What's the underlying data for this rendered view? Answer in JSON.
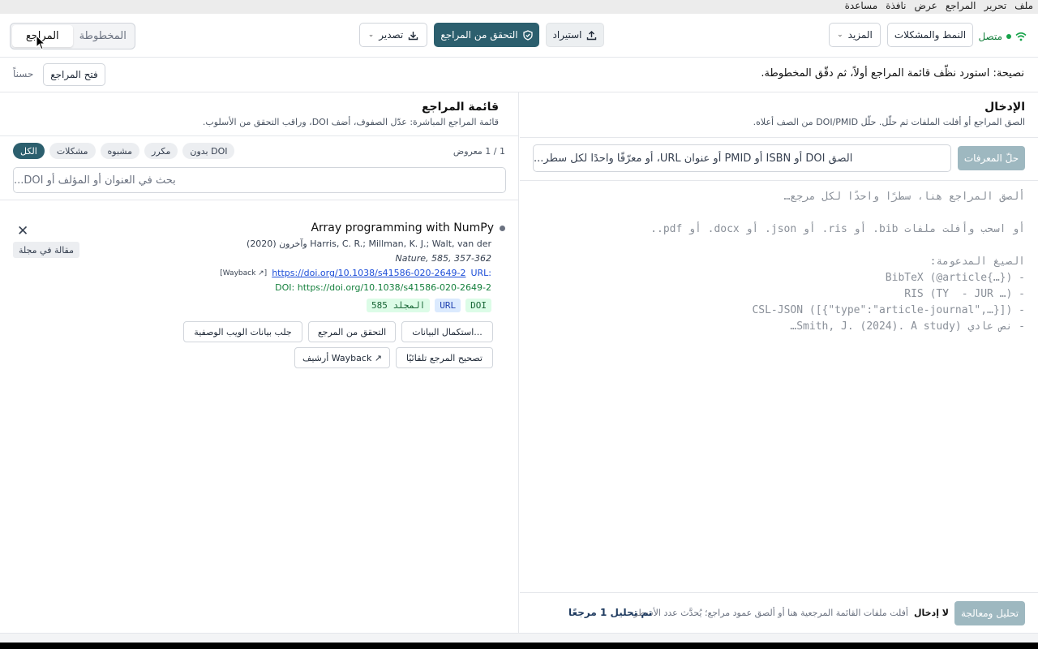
{
  "menu": [
    "ملف",
    "تحرير",
    "المراجع",
    "عرض",
    "نافذة",
    "مساعدة"
  ],
  "toolbar": {
    "status": "متصل",
    "issues_label": "النمط والمشكلات",
    "more_label": "المزيد",
    "import_label": "استيراد",
    "verify_label": "التحقق من المراجع",
    "export_label": "تصدير",
    "tab_manuscript": "المخطوطة",
    "tab_references": "المراجع"
  },
  "tip": {
    "text": "نصيحة: استورد نظّف قائمة المراجع أولاً، ثم دقّق المخطوطة.",
    "open_label": "فتح المراجع",
    "ok_label": "حسناً"
  },
  "input_panel": {
    "title": "الإدخال",
    "subtitle": "الصق المراجع أو أفلت الملفات ثم حلّل. حلّل DOI/PMID من الصف أعلاه.",
    "resolve_label": "حلّ المعرفات",
    "identifier_placeholder": "الصق DOI أو ISBN أو PMID أو عنوان URL، أو معرّفًا واحدًا لكل سطر...",
    "textarea_lines": [
      "ألصق المراجع هنا، سطرًا واحدًا لكل مرجع…",
      "",
      "أو اسحب وأفلت ملفات bib. أو ris. أو json. أو docx. أو pdf..",
      "",
      "الصيغ المدعومة:",
      "- BibTeX (@article{…})",
      "- RIS (TY  - JUR …)",
      "- CSL-JSON ([{\"type\":\"article-journal\",…}])",
      "- نص عادي (Smith, J. (2024). A study…"
    ],
    "parse_label": "تحليل ومعالجة",
    "footer_hint_bold": "لا إدخال",
    "footer_hint": "أفلت ملفات القائمة المرجعية هنا أو ألصق عمود مراجع؛ يُحدَّث عدد الأسطر.",
    "footer_status": "تم تحليل 1 مرجعًا"
  },
  "ref_panel": {
    "title": "قائمة المراجع",
    "subtitle": "قائمة المراجع المباشرة: عدّل الصفوف، أضف DOI، وراقب التحقق من الأسلوب.",
    "count": "1 / 1 معروض",
    "filters": [
      "بدون DOI",
      "مكرر",
      "مشبوه",
      "مشكلات",
      "الكل"
    ],
    "search_placeholder": "بحث في العنوان أو المؤلف أو DOI..."
  },
  "reference": {
    "title": "Array programming with NumPy",
    "authors": "Harris, C. R.; Millman, K. J.; Walt, van der وآخرون (2020)",
    "journal": "Nature, 585, 357-362",
    "url_label": "URL:",
    "url": "https://doi.org/10.1038/s41586-020-2649-2",
    "wayback": "[Wayback ↗]",
    "doi": "DOI: https://doi.org/10.1038/s41586-020-2649-2",
    "tags": [
      "DOI",
      "URL",
      "المجلد 585"
    ],
    "type_badge": "مقالة في مجلة",
    "actions": [
      "استكمال البيانات...",
      "التحقق من المرجع",
      "جلب بيانات الويب الوصفية",
      "تصحيح المرجع تلقائيًا",
      "أرشيف Wayback ↗"
    ]
  },
  "colors": {
    "accent": "#2c5f6e",
    "success": "#16a34a",
    "link": "#1d4ed8"
  }
}
